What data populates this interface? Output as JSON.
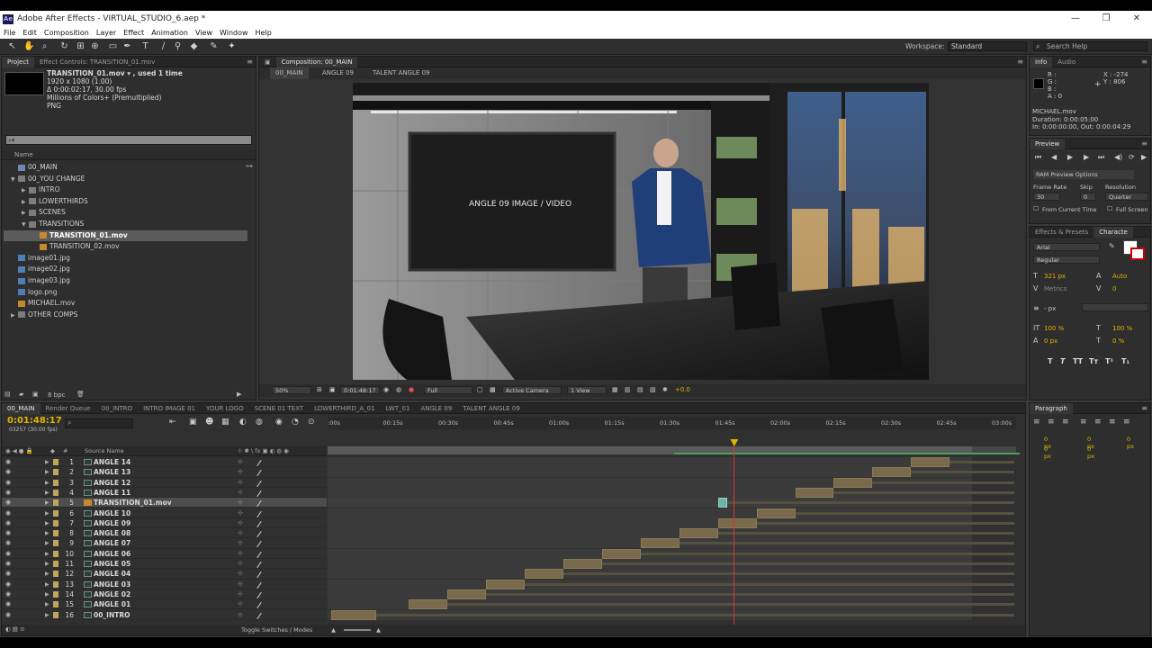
{
  "window": {
    "title": "Adobe After Effects - VIRTUAL_STUDIO_6.aep *",
    "app_icon": "Ae",
    "min": "—",
    "max": "❐",
    "close": "✕"
  },
  "menu": [
    "File",
    "Edit",
    "Composition",
    "Layer",
    "Effect",
    "Animation",
    "View",
    "Window",
    "Help"
  ],
  "toolbar": {
    "workspace_label": "Workspace:",
    "workspace_value": "Standard",
    "search_placeholder": "Search Help"
  },
  "project": {
    "tab_project": "Project",
    "tab_effects": "Effect Controls: TRANSITION_01.mov",
    "info_name": "TRANSITION_01.mov ▾ , used 1 time",
    "info_lines": [
      "1920 x 1080 (1.00)",
      "Δ 0:00:02:17, 30.00 fps",
      "Millions of Colors+ (Premultiplied)",
      "PNG"
    ],
    "search_placeholder": "⌕▾",
    "column_name": "Name",
    "items": [
      {
        "label": "00_MAIN",
        "type": "comp",
        "indent": 0,
        "twirl": ""
      },
      {
        "label": "00_YOU CHANGE",
        "type": "folder",
        "indent": 0,
        "twirl": "▼"
      },
      {
        "label": "INTRO",
        "type": "folder",
        "indent": 1,
        "twirl": "▶"
      },
      {
        "label": "LOWERTHIRDS",
        "type": "folder",
        "indent": 1,
        "twirl": "▶"
      },
      {
        "label": "SCENES",
        "type": "folder",
        "indent": 1,
        "twirl": "▶"
      },
      {
        "label": "TRANSITIONS",
        "type": "folder",
        "indent": 1,
        "twirl": "▼"
      },
      {
        "label": "TRANSITION_01.mov",
        "type": "vid",
        "indent": 2,
        "twirl": "",
        "selected": true
      },
      {
        "label": "TRANSITION_02.mov",
        "type": "vid",
        "indent": 2,
        "twirl": ""
      },
      {
        "label": "image01.jpg",
        "type": "img",
        "indent": 0,
        "twirl": ""
      },
      {
        "label": "image02.jpg",
        "type": "img",
        "indent": 0,
        "twirl": ""
      },
      {
        "label": "image03.jpg",
        "type": "img",
        "indent": 0,
        "twirl": ""
      },
      {
        "label": "logo.png",
        "type": "img",
        "indent": 0,
        "twirl": ""
      },
      {
        "label": "MICHAEL.mov",
        "type": "vid",
        "indent": 0,
        "twirl": ""
      },
      {
        "label": "OTHER COMPS",
        "type": "folder",
        "indent": 0,
        "twirl": "▶"
      }
    ],
    "bpc": "8 bpc"
  },
  "composition": {
    "tab": "Composition: 00_MAIN",
    "crumbs": [
      "00_MAIN",
      "ANGLE 09",
      "TALENT ANGLE 09"
    ],
    "screen_text": "ANGLE 09 IMAGE / VIDEO",
    "zoom": "50%",
    "timecode": "0:01:48:17",
    "resolution": "Full",
    "camera": "Active Camera",
    "view": "1 View",
    "exposure": "+0.0"
  },
  "info": {
    "tab_info": "Info",
    "tab_audio": "Audio",
    "rgba": [
      "R :",
      "G :",
      "B :",
      "A : 0"
    ],
    "x": "X : -274",
    "y": "Y : 806",
    "clip": [
      "MICHAEL.mov",
      "Duration: 0:00:05:00",
      "In: 0:00:00:00, Out: 0:00:04:29"
    ]
  },
  "preview": {
    "tab": "Preview",
    "ram": "RAM Preview Options",
    "frame_rate_label": "Frame Rate",
    "skip_label": "Skip",
    "res_label": "Resolution",
    "frame_rate": "30",
    "skip": "0",
    "res": "Quarter",
    "from_current": "From Current Time",
    "full_screen": "Full Screen"
  },
  "character": {
    "tab_effects": "Effects & Presets",
    "tab_char": "Characte",
    "font": "Arial",
    "style": "Regular",
    "size": "321 px",
    "leading": "Auto",
    "kerning": "Metrics",
    "tracking": "0",
    "stroke_px": "- px",
    "vscale": "100 %",
    "hscale": "100 %",
    "baseline": "0 px",
    "tsume": "0 %"
  },
  "paragraph": {
    "tab": "Paragraph",
    "values": [
      "0 px",
      "0 px",
      "0 px",
      "0 px",
      "0 px"
    ]
  },
  "timeline": {
    "tabs": [
      "00_MAIN",
      "Render Queue",
      "00_INTRO",
      "INTRO IMAGE 01",
      "YOUR LOGO",
      "SCENE 01 TEXT",
      "LOWERTHIRD_A_01",
      "LWT_01",
      "ANGLE 09",
      "TALENT ANGLE 09"
    ],
    "timecode": "0:01:48:17",
    "frames": "03257 (30.00 fps)",
    "col_source": "Source Name",
    "col_num": "#",
    "ruler": [
      ":00s",
      "00:15s",
      "00:30s",
      "00:45s",
      "01:00s",
      "01:15s",
      "01:30s",
      "01:45s",
      "02:00s",
      "02:15s",
      "02:30s",
      "02:45s",
      "03:00s"
    ],
    "layers": [
      {
        "num": "1",
        "name": "ANGLE 14",
        "start": 0.9,
        "end": 0.96
      },
      {
        "num": "2",
        "name": "ANGLE 13",
        "start": 0.84,
        "end": 0.9
      },
      {
        "num": "3",
        "name": "ANGLE 12",
        "start": 0.78,
        "end": 0.84
      },
      {
        "num": "4",
        "name": "ANGLE 11",
        "start": 0.72,
        "end": 0.78
      },
      {
        "num": "5",
        "name": "TRANSITION_01.mov",
        "start": 0.6,
        "end": 0.615,
        "selected": true,
        "type": "vid"
      },
      {
        "num": "6",
        "name": "ANGLE 10",
        "start": 0.66,
        "end": 0.72
      },
      {
        "num": "7",
        "name": "ANGLE 09",
        "start": 0.6,
        "end": 0.66
      },
      {
        "num": "8",
        "name": "ANGLE 08",
        "start": 0.54,
        "end": 0.6
      },
      {
        "num": "9",
        "name": "ANGLE 07",
        "start": 0.48,
        "end": 0.54
      },
      {
        "num": "10",
        "name": "ANGLE 06",
        "start": 0.42,
        "end": 0.48
      },
      {
        "num": "11",
        "name": "ANGLE 05",
        "start": 0.36,
        "end": 0.42
      },
      {
        "num": "12",
        "name": "ANGLE 04",
        "start": 0.3,
        "end": 0.36
      },
      {
        "num": "13",
        "name": "ANGLE 03",
        "start": 0.24,
        "end": 0.3
      },
      {
        "num": "14",
        "name": "ANGLE 02",
        "start": 0.18,
        "end": 0.24
      },
      {
        "num": "15",
        "name": "ANGLE 01",
        "start": 0.12,
        "end": 0.18
      },
      {
        "num": "16",
        "name": "00_INTRO",
        "start": 0.0,
        "end": 0.07
      }
    ],
    "playhead": 0.59,
    "toggle": "Toggle Switches / Modes"
  },
  "colors": {
    "accent": "#e0b400",
    "bar": "#786a4a",
    "playhead": "#e03030"
  }
}
